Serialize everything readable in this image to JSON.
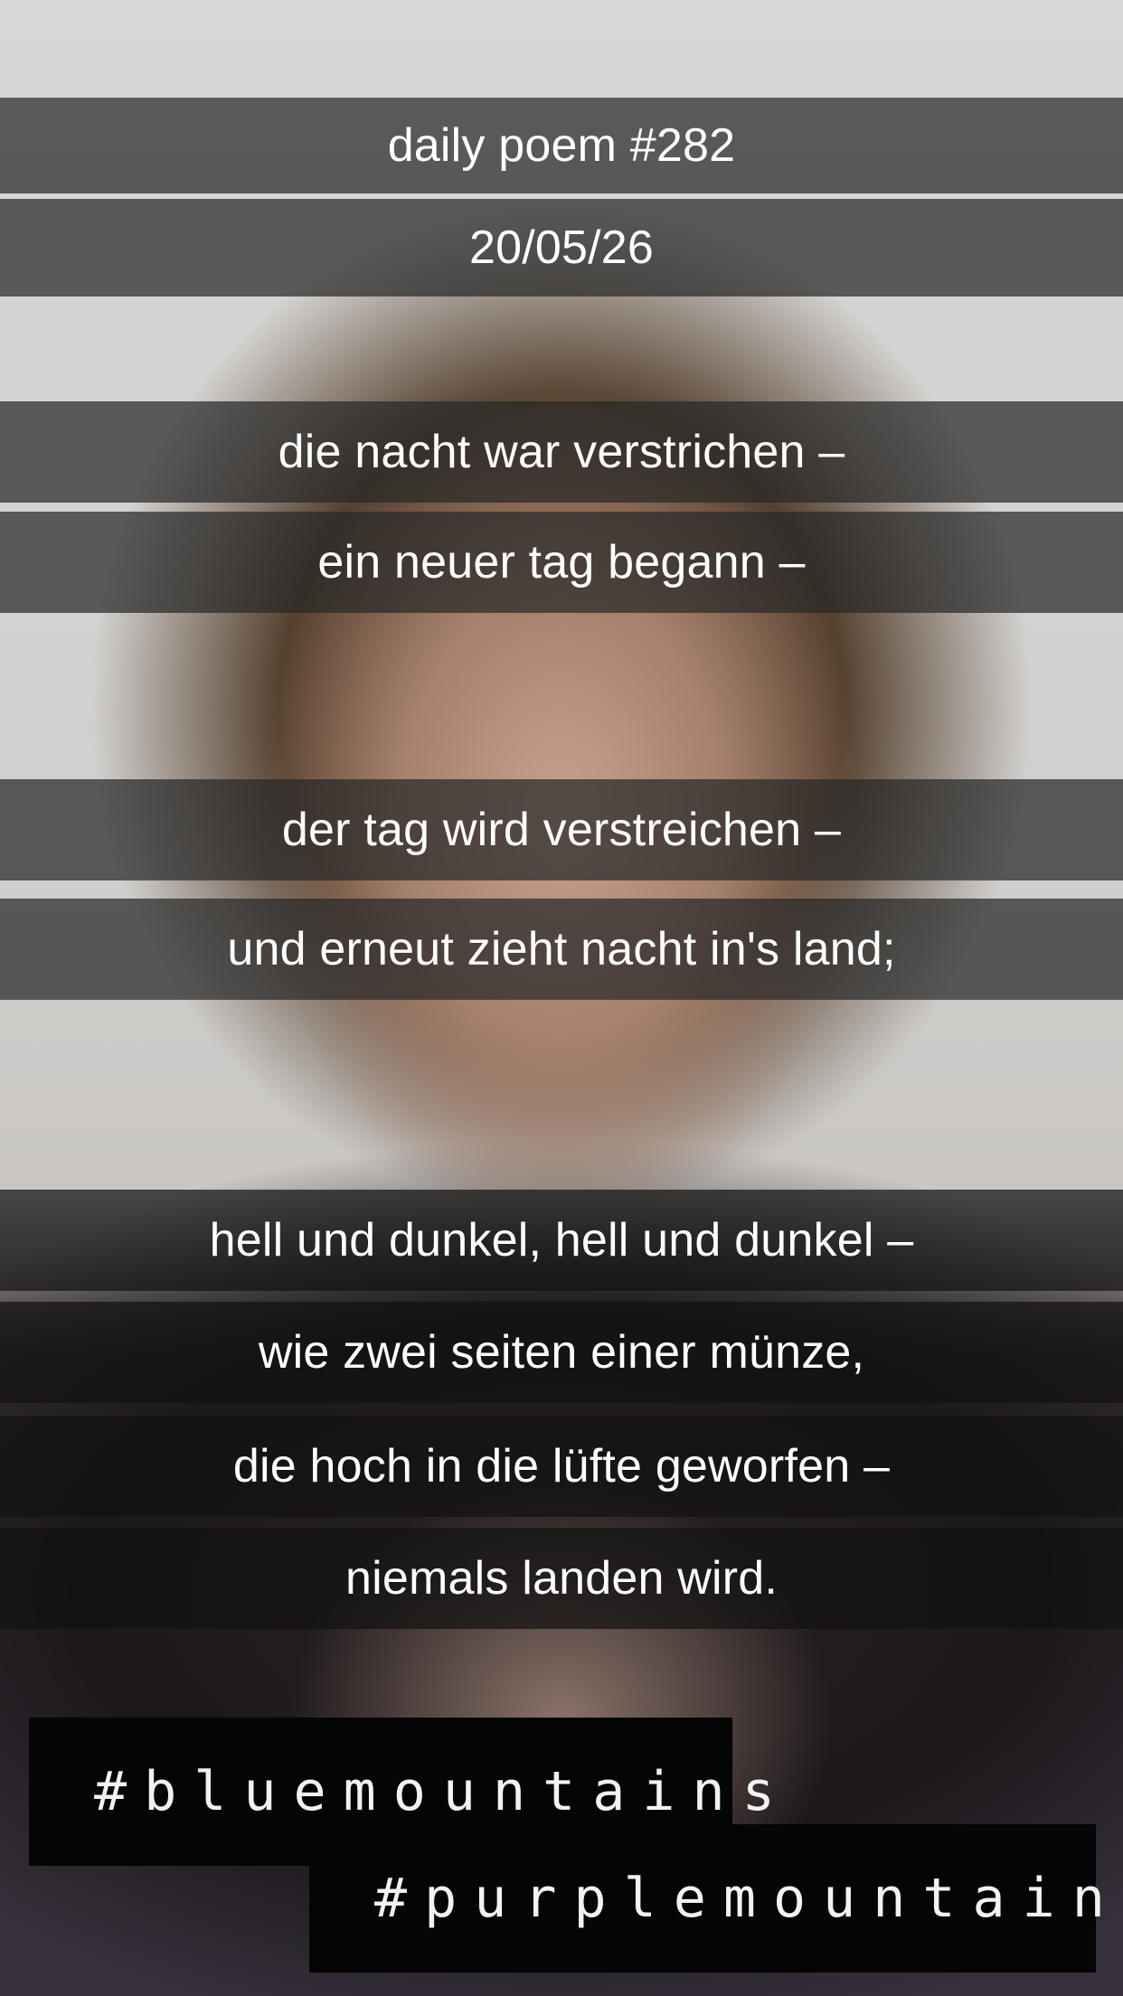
{
  "header": {
    "title": "daily poem #282",
    "date": "20/05/26"
  },
  "poem": {
    "stanza1": [
      "die nacht war verstrichen –",
      "ein neuer tag begann –"
    ],
    "stanza2": [
      "der tag wird verstreichen –",
      "und erneut zieht nacht in's land;"
    ],
    "stanza3": [
      "hell und dunkel, hell und dunkel –",
      "wie zwei seiten einer münze,",
      "die hoch in die lüfte geworfen –",
      "niemals landen wird."
    ]
  },
  "hashtags": [
    "#bluemountains",
    "#purplemountains"
  ]
}
